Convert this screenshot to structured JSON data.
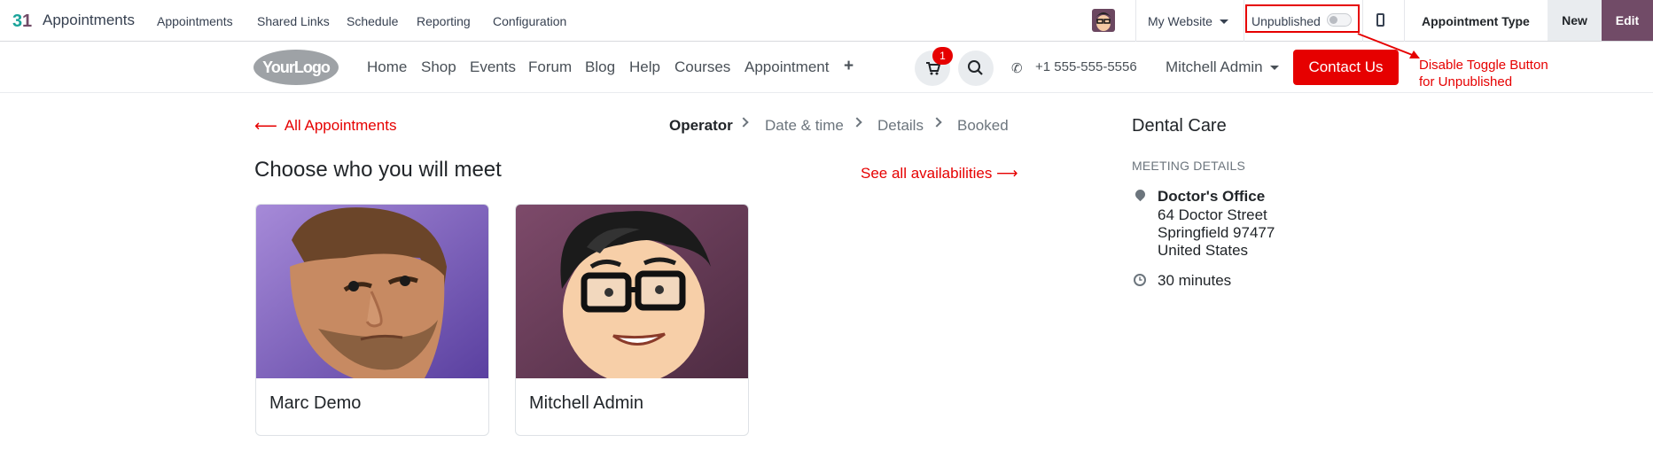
{
  "admin_bar": {
    "app_name": "Appointments",
    "menu": [
      "Appointments",
      "Shared Links",
      "Schedule",
      "Reporting",
      "Configuration"
    ],
    "website_selector": "My Website",
    "publish_label": "Unpublished",
    "publish_toggle_on": false,
    "record_title": "Appointment Type",
    "new_label": "New",
    "edit_label": "Edit"
  },
  "site_header": {
    "logo_text": "YourLogo",
    "nav": [
      "Home",
      "Shop",
      "Events",
      "Forum",
      "Blog",
      "Help",
      "Courses",
      "Appointment"
    ],
    "cart_count": "1",
    "phone": "+1 555-555-5556",
    "user_menu": "Mitchell Admin",
    "contact_label": "Contact Us"
  },
  "annotation": {
    "line1": "Disable Toggle Button",
    "line2": "for Unpublished"
  },
  "main": {
    "back_label": "All Appointments",
    "steps": [
      "Operator",
      "Date & time",
      "Details",
      "Booked"
    ],
    "active_step": "Operator",
    "title": "Choose who you will meet",
    "see_all_label": "See all availabilities",
    "operators": [
      {
        "name": "Marc Demo"
      },
      {
        "name": "Mitchell Admin"
      }
    ]
  },
  "sidebar": {
    "title": "Dental Care",
    "subheading": "MEETING DETAILS",
    "location_name": "Doctor's Office",
    "address_line1": "64 Doctor Street",
    "address_line2": "Springfield 97477",
    "address_line3": "United States",
    "duration": "30 minutes"
  },
  "colors": {
    "brand_purple": "#714b67",
    "accent_red": "#e60000"
  }
}
